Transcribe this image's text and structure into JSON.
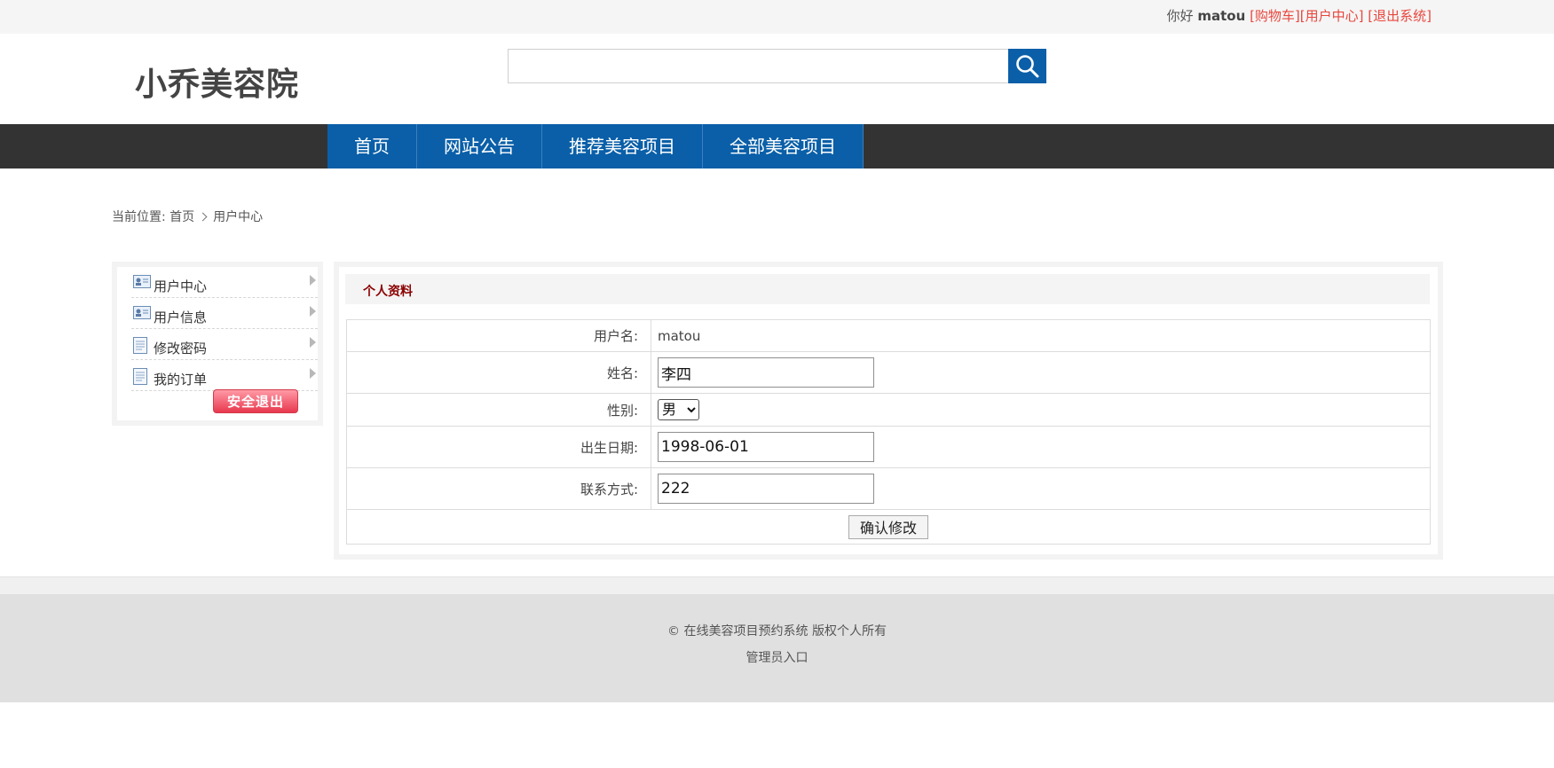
{
  "topbar": {
    "greeting": "你好",
    "username": "matou",
    "links": [
      "[购物车]",
      "[用户中心]",
      "[退出系统]"
    ]
  },
  "header": {
    "logo_text": "小乔美容院",
    "search": {
      "value": "",
      "placeholder": ""
    },
    "search_icon": "search-icon"
  },
  "nav": {
    "items": [
      "首页",
      "网站公告",
      "推荐美容项目",
      "全部美容项目"
    ]
  },
  "breadcrumb": {
    "prefix": "当前位置:",
    "home": "首页",
    "current": "用户中心"
  },
  "sidebar": {
    "items": [
      {
        "label": "用户中心",
        "icon": "id-card-icon"
      },
      {
        "label": "用户信息",
        "icon": "id-card-icon"
      },
      {
        "label": "修改密码",
        "icon": "document-icon"
      },
      {
        "label": "我的订单",
        "icon": "document-icon"
      }
    ],
    "logout_label": "安全退出"
  },
  "profile": {
    "title": "个人资料",
    "username_label": "用户名:",
    "username_value": "matou",
    "name_label": "姓名:",
    "name_value": "李四",
    "gender_label": "性别:",
    "gender_value": "男",
    "birth_label": "出生日期:",
    "birth_value": "1998-06-01",
    "contact_label": "联系方式:",
    "contact_value": "222",
    "submit_label": "确认修改"
  },
  "footer": {
    "copyright": "© 在线美容项目预约系统 版权个人所有",
    "admin_link": "管理员入口"
  },
  "colors": {
    "brand_blue": "#0a5fa8",
    "nav_bg": "#333333",
    "link_red": "#e8473e",
    "panel_title": "#8b0000"
  }
}
